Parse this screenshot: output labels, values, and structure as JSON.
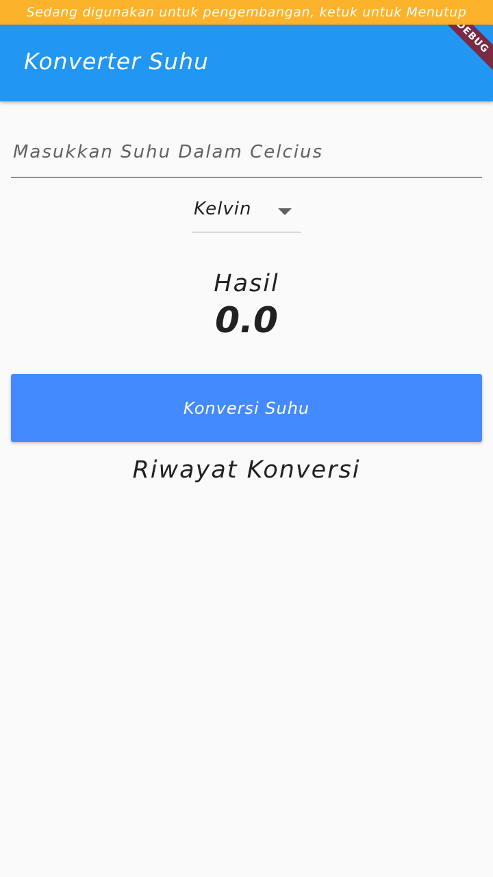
{
  "dev_banner": {
    "text": "Sedang digunakan untuk pengembangan, ketuk untuk Menutup"
  },
  "app_bar": {
    "title": "Konverter Suhu",
    "debug_ribbon": "DEBUG",
    "color": "#2196f3"
  },
  "input": {
    "placeholder": "Masukkan Suhu Dalam Celcius",
    "value": ""
  },
  "dropdown": {
    "selected": "Kelvin",
    "icon": "arrow-drop-down-icon"
  },
  "result": {
    "label": "Hasil",
    "value": "0.0"
  },
  "convert_button": {
    "label": "Konversi Suhu",
    "color": "#448aff"
  },
  "history": {
    "title": "Riwayat Konversi",
    "items": []
  }
}
